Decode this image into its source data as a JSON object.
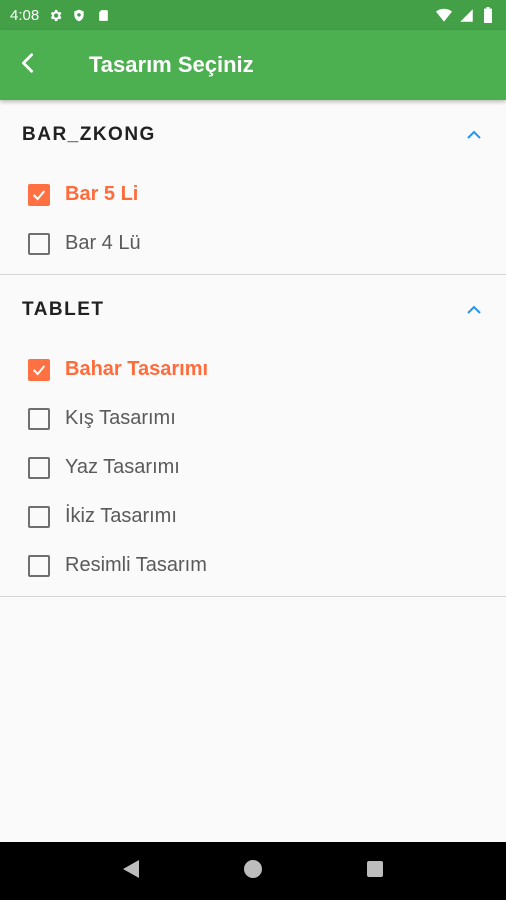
{
  "status_bar": {
    "time": "4:08",
    "left_icons": [
      "gear-icon",
      "shield-icon",
      "sd-card-icon"
    ],
    "right_icons": [
      "wifi-icon",
      "signal-icon",
      "battery-icon"
    ]
  },
  "app_bar": {
    "title": "Tasarım Seçiniz",
    "back_icon": "back-arrow-icon",
    "background": "#4caf50"
  },
  "sections": [
    {
      "title": "BAR_ZKONG",
      "expanded": true,
      "options": [
        {
          "label": "Bar 5 Li",
          "checked": true
        },
        {
          "label": "Bar 4 Lü",
          "checked": false
        }
      ]
    },
    {
      "title": "TABLET",
      "expanded": true,
      "options": [
        {
          "label": "Bahar Tasarımı",
          "checked": true
        },
        {
          "label": "Kış Tasarımı",
          "checked": false
        },
        {
          "label": "Yaz Tasarımı",
          "checked": false
        },
        {
          "label": "İkiz Tasarımı",
          "checked": false
        },
        {
          "label": "Resimli Tasarım",
          "checked": false
        }
      ]
    }
  ],
  "colors": {
    "accent": "#ff7043",
    "chevron": "#2196f3",
    "status_bar": "#43a047"
  },
  "nav_bar": {
    "icons": [
      "back-triangle-icon",
      "home-circle-icon",
      "recents-square-icon"
    ]
  }
}
